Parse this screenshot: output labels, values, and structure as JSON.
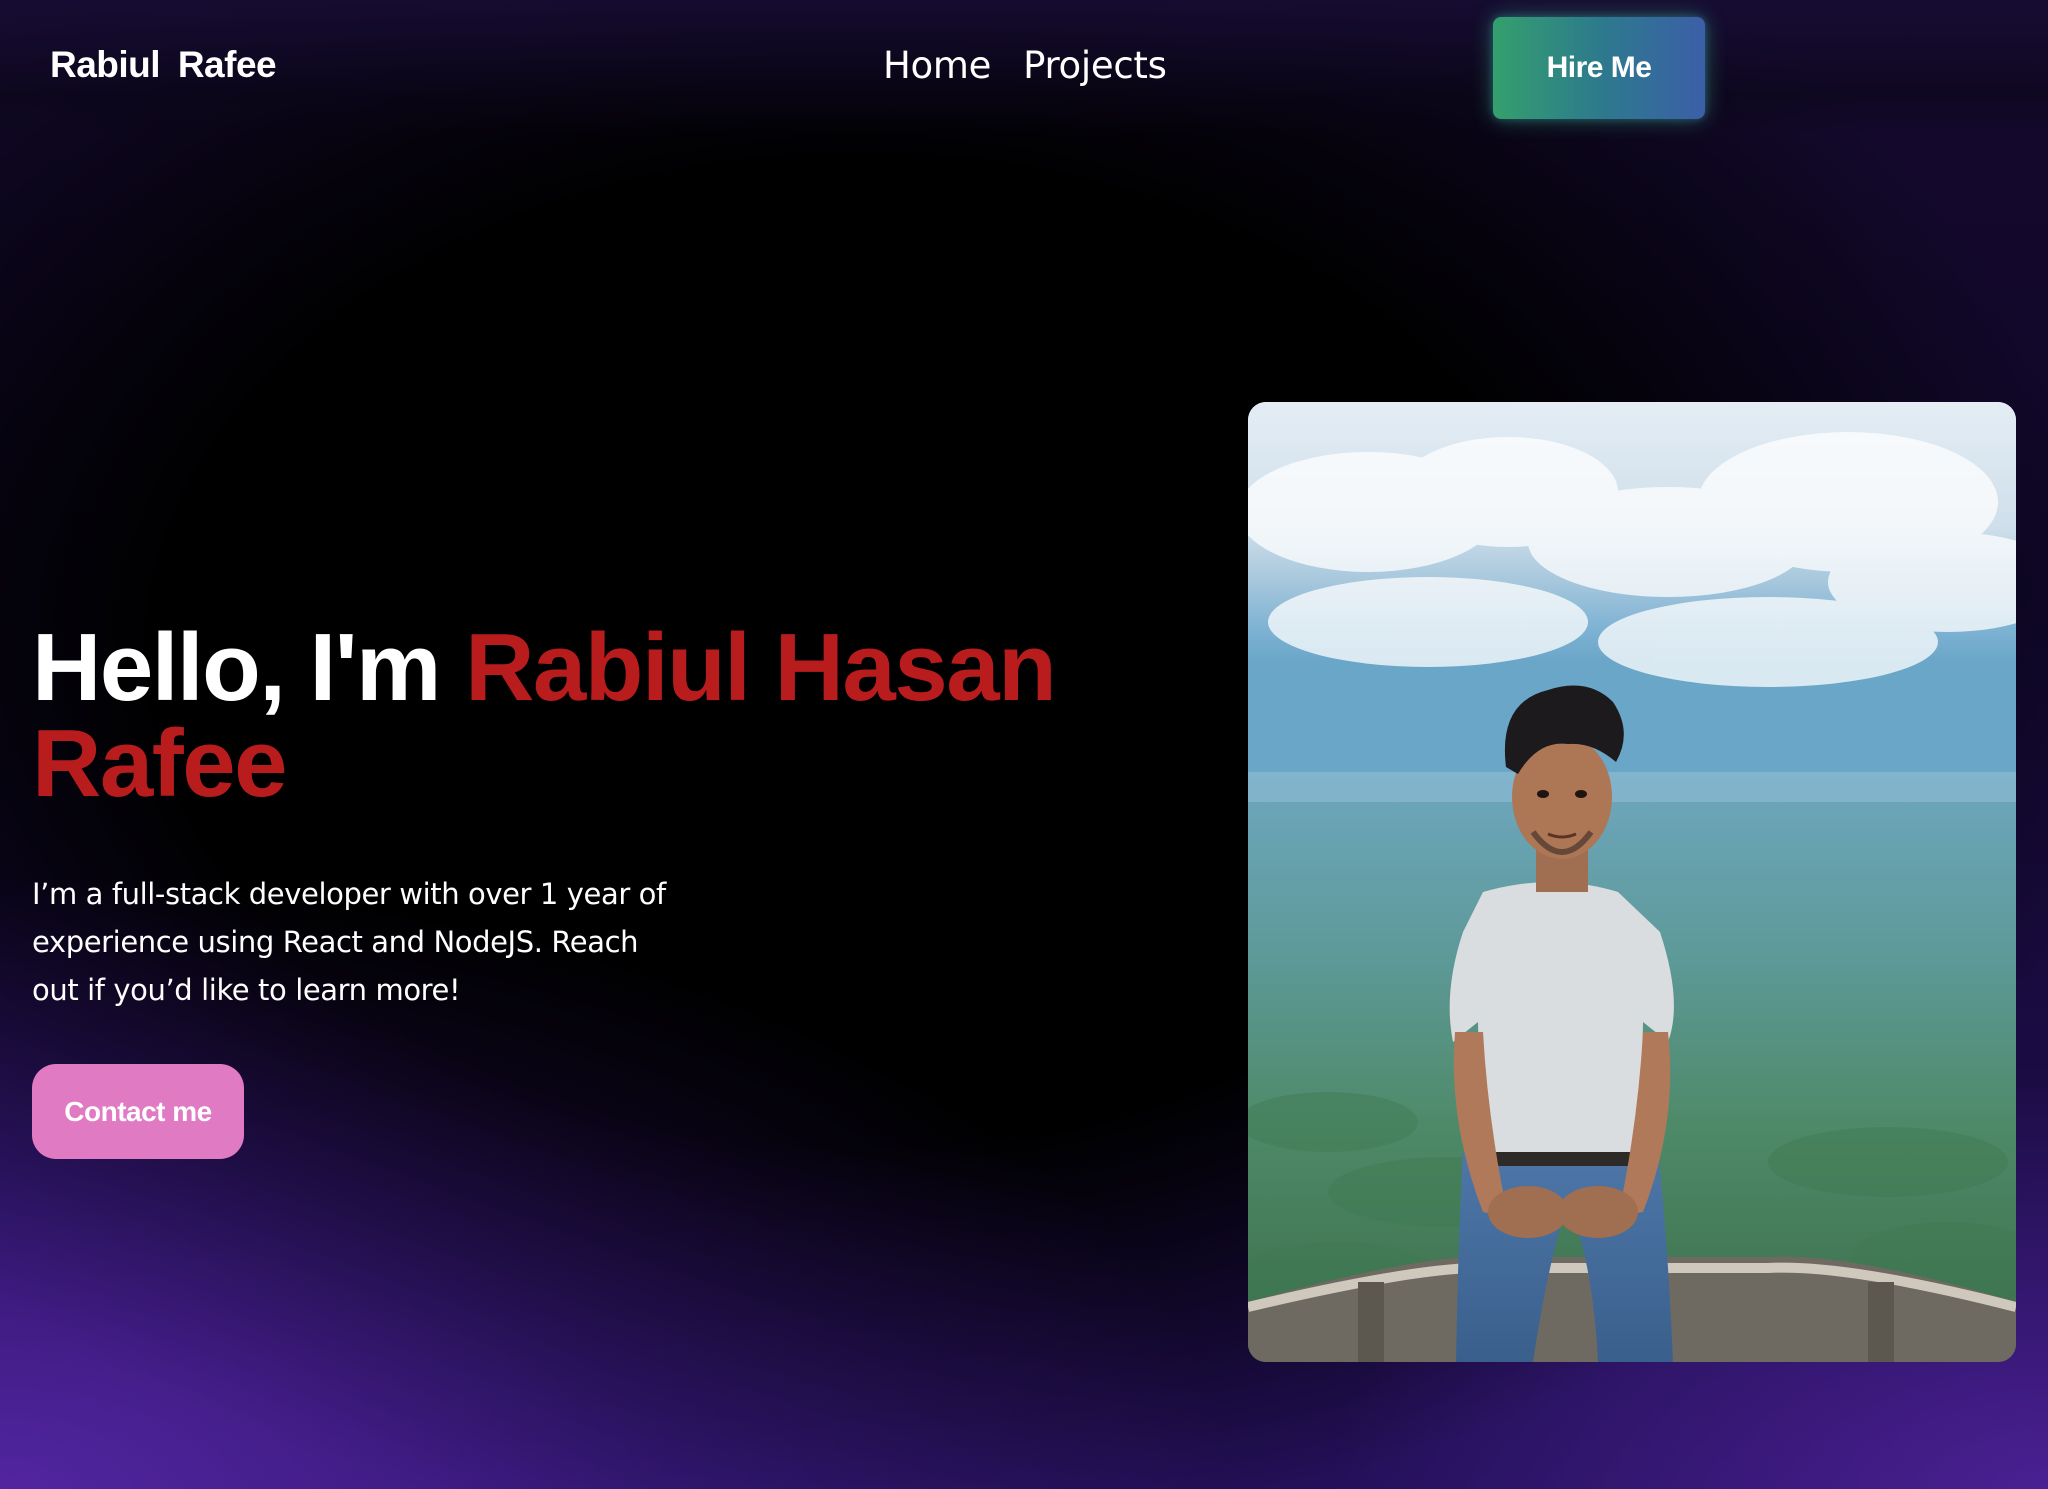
{
  "header": {
    "brand": "Rabiul  Rafee",
    "nav": [
      {
        "label": "Home"
      },
      {
        "label": "Projects"
      }
    ],
    "hire_label": "Hire Me"
  },
  "hero": {
    "greeting": "Hello, I'm ",
    "name": "Rabiul Hasan Rafee",
    "description": "I’m a full-stack developer with over 1 year of experience using React and NodeJS. Reach out if you’d like to learn more!",
    "contact_label": "Contact me"
  },
  "colors": {
    "name_accent": "#b91c1c",
    "contact_button": "#e07ac3",
    "hire_gradient_start": "#34a06d",
    "hire_gradient_end": "#3b5fa8",
    "background": "#000000",
    "background_glow": "#2a1260"
  }
}
